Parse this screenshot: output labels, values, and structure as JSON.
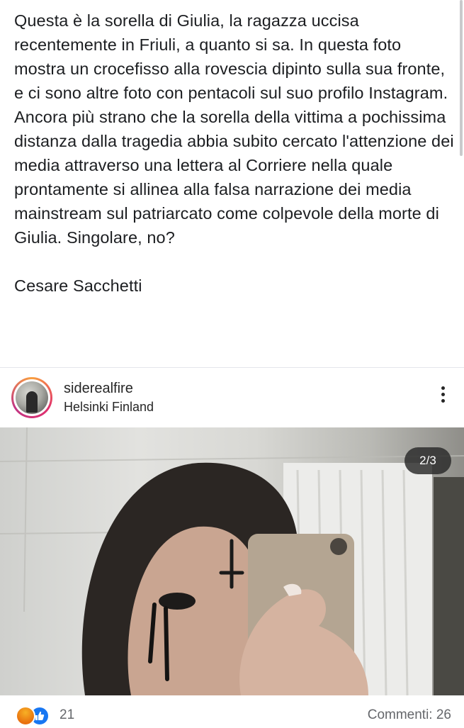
{
  "post": {
    "body": "Questa è la sorella di Giulia, la ragazza uccisa recentemente in Friuli, a quanto si sa. In questa foto mostra un crocefisso alla rovescia dipinto sulla sua fronte, e ci sono altre foto con pentacoli sul suo profilo Instagram. Ancora più strano che la sorella della vittima a pochissima distanza dalla tragedia abbia subito cercato l'attenzione dei media attraverso una lettera al Corriere nella quale prontamente si allinea alla falsa narrazione dei media mainstream sul patriarcato come colpevole della morte di Giulia. Singolare, no?",
    "signature": "Cesare Sacchetti"
  },
  "instagram": {
    "username": "siderealfire",
    "location": "Helsinki Finland",
    "carousel_counter": "2/3",
    "more_icon": "more-vertical-icon"
  },
  "footer": {
    "reactions_count": "21",
    "reaction_icons": [
      "angry-reaction-icon",
      "like-reaction-icon"
    ],
    "comments_label": "Commenti: 26"
  },
  "colors": {
    "text": "#1c1e21",
    "secondary_text": "#65676b",
    "like_blue": "#1877f2",
    "angry_orange": "#e9710f"
  }
}
